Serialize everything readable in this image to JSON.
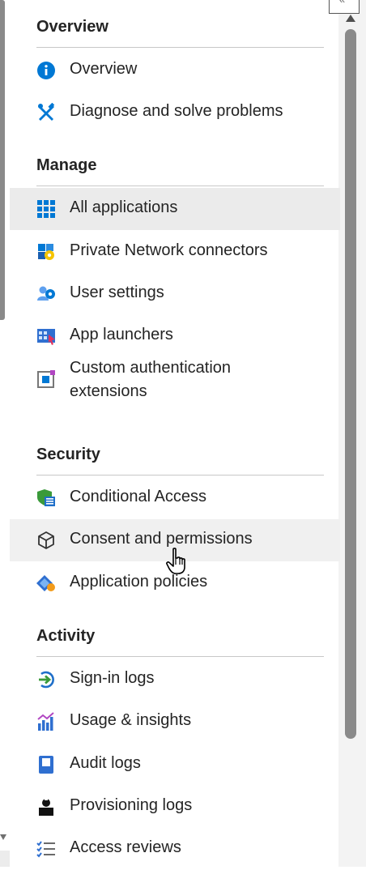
{
  "sections": [
    {
      "title": "Overview",
      "items": [
        {
          "label": "Overview",
          "icon": "info-icon"
        },
        {
          "label": "Diagnose and solve problems",
          "icon": "tools-icon"
        }
      ]
    },
    {
      "title": "Manage",
      "items": [
        {
          "label": "All applications",
          "icon": "grid-icon",
          "selected": true
        },
        {
          "label": "Private Network connectors",
          "icon": "connector-icon"
        },
        {
          "label": "User settings",
          "icon": "user-settings-icon"
        },
        {
          "label": "App launchers",
          "icon": "app-launcher-icon"
        },
        {
          "label": "Custom authentication extensions",
          "icon": "extension-icon"
        }
      ]
    },
    {
      "title": "Security",
      "items": [
        {
          "label": "Conditional Access",
          "icon": "shield-list-icon"
        },
        {
          "label": "Consent and permissions",
          "icon": "cube-icon",
          "hovered": true
        },
        {
          "label": "Application policies",
          "icon": "policy-icon"
        }
      ]
    },
    {
      "title": "Activity",
      "items": [
        {
          "label": "Sign-in logs",
          "icon": "sign-in-icon"
        },
        {
          "label": "Usage & insights",
          "icon": "chart-icon"
        },
        {
          "label": "Audit logs",
          "icon": "book-icon"
        },
        {
          "label": "Provisioning logs",
          "icon": "person-icon"
        },
        {
          "label": "Access reviews",
          "icon": "checklist-icon"
        }
      ]
    }
  ],
  "colors": {
    "accent": "#0078d4",
    "selected_bg": "#ebebeb",
    "hover_bg": "#f0f0f0"
  }
}
